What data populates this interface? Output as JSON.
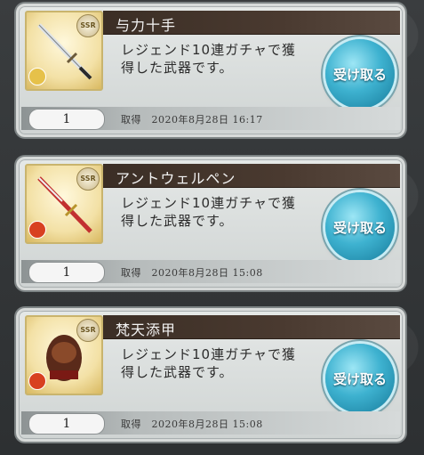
{
  "items": [
    {
      "name": "与力十手",
      "description_line1": "レジェンド10連ガチャで獲",
      "description_line2": "得した武器です。",
      "button_label": "受け取る",
      "quantity": "1",
      "date_label": "取得　2020年8月28日 16:17",
      "rarity": "SSR",
      "element_color": "#e6c14a"
    },
    {
      "name": "アントウェルペン",
      "description_line1": "レジェンド10連ガチャで獲",
      "description_line2": "得した武器です。",
      "button_label": "受け取る",
      "quantity": "1",
      "date_label": "取得　2020年8月28日 15:08",
      "rarity": "SSR",
      "element_color": "#d84020"
    },
    {
      "name": "梵天添甲",
      "description_line1": "レジェンド10連ガチャで獲",
      "description_line2": "得した武器です。",
      "button_label": "受け取る",
      "quantity": "1",
      "date_label": "取得　2020年8月28日 15:08",
      "rarity": "SSR",
      "element_color": "#d84020"
    }
  ]
}
